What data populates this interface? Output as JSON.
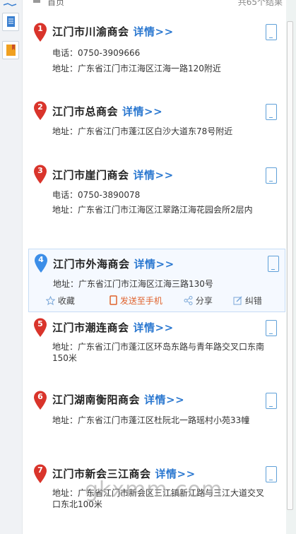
{
  "header": {
    "home": "首页",
    "count": "共65个结果"
  },
  "detail_label": "详情>>",
  "actions": {
    "favorite": "收藏",
    "send": "发送至手机",
    "share": "分享",
    "correct": "纠错"
  },
  "colors": {
    "red_marker": "#d9342b",
    "blue_marker": "#3c8ee8",
    "link": "#2b78d0"
  },
  "results": [
    {
      "num": "1",
      "name": "江门市川渝商会",
      "phone": "电话：0750-3909666",
      "address": "地址：广东省江门市江海区江海一路120附近"
    },
    {
      "num": "2",
      "name": "江门市总商会",
      "address": "地址：广东省江门市蓬江区白沙大道东78号附近"
    },
    {
      "num": "3",
      "name": "江门市崖门商会",
      "phone": "电话：0750-3890078",
      "address": "地址：广东省江门市江海区江翠路江海花园会所2层内"
    },
    {
      "num": "4",
      "name": "江门市外海商会",
      "address": "地址：广东省江门市江海区江海三路130号"
    },
    {
      "num": "5",
      "name": "江门市潮连商会",
      "address": "地址：广东省江门市蓬江区环岛东路与青年路交叉口东南150米"
    },
    {
      "num": "6",
      "name": "江门湖南衡阳商会",
      "address": "地址：广东省江门市蓬江区杜阮北一路瑶村小苑33幢"
    },
    {
      "num": "7",
      "name": "江门市新会三江商会",
      "address": "地址：广东省江门市新会区三江镇新江路与三江大道交叉口东北100米"
    }
  ],
  "watermark": "gkxmm.com"
}
